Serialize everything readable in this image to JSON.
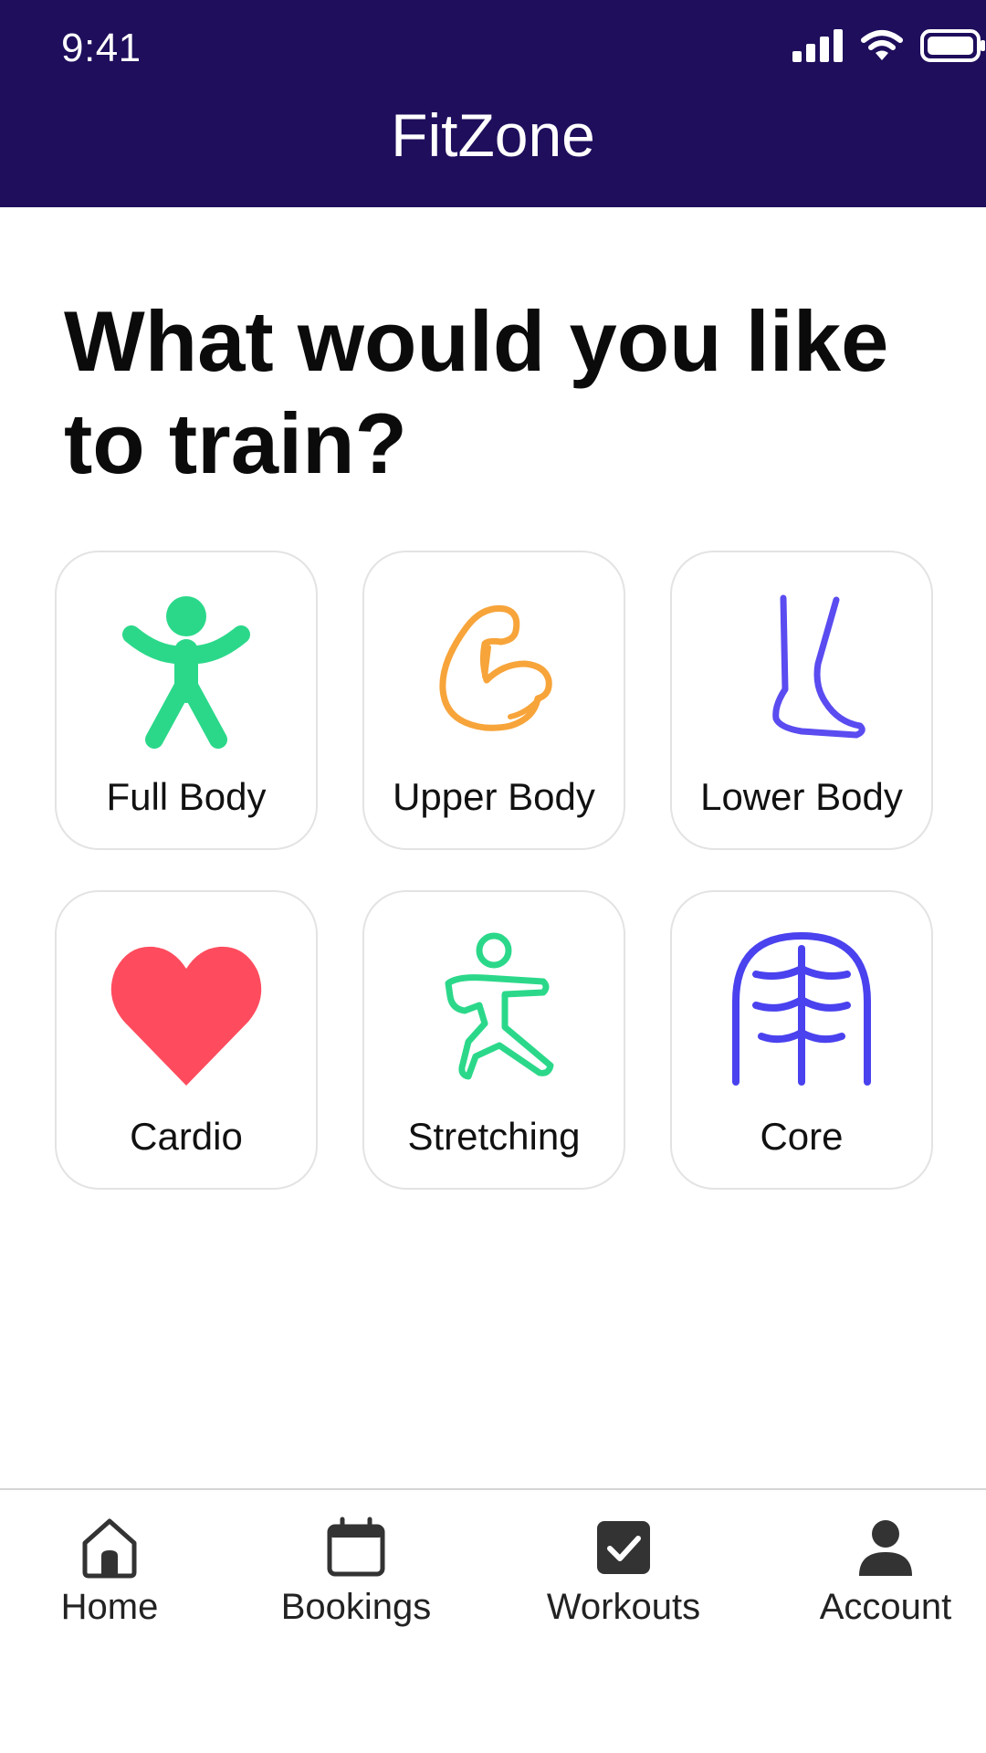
{
  "status_bar": {
    "time": "9:41",
    "icons": [
      "signal-icon",
      "wifi-icon",
      "battery-icon"
    ]
  },
  "header": {
    "title": "FitZone",
    "background": "#1f0e5c"
  },
  "main": {
    "heading": "What would you like to train?",
    "categories": [
      {
        "label": "Full Body",
        "icon": "person-icon",
        "color": "#2bd88a"
      },
      {
        "label": "Upper Body",
        "icon": "flexed-arm-icon",
        "color": "#f7a43a"
      },
      {
        "label": "Lower Body",
        "icon": "leg-icon",
        "color": "#5a4cf0"
      },
      {
        "label": "Cardio",
        "icon": "heart-icon",
        "color": "#fe4c5e"
      },
      {
        "label": "Stretching",
        "icon": "stretching-figure-icon",
        "color": "#2bd88a"
      },
      {
        "label": "Core",
        "icon": "ribcage-icon",
        "color": "#4a42ee"
      }
    ]
  },
  "bottom_nav": {
    "items": [
      {
        "label": "Home",
        "icon": "home-icon"
      },
      {
        "label": "Bookings",
        "icon": "calendar-icon"
      },
      {
        "label": "Workouts",
        "icon": "checkbox-icon"
      },
      {
        "label": "Account",
        "icon": "user-icon"
      }
    ]
  }
}
